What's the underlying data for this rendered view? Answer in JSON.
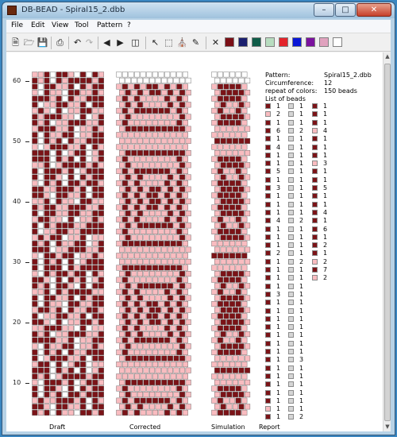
{
  "window": {
    "title": "DB-BEAD - Spiral15_2.dbb",
    "min": "–",
    "max": "□",
    "close": "✕"
  },
  "menu": [
    "File",
    "Edit",
    "View",
    "Tool",
    "Pattern",
    "?"
  ],
  "toolbar": {
    "icons": [
      "new-file-icon",
      "open-folder-icon",
      "save-icon",
      "print-icon",
      "undo-icon",
      "redo-icon",
      "arrow-left-icon",
      "arrow-right-icon",
      "preview-icon",
      "pointer-icon",
      "select-rect-icon",
      "fill-bucket-icon",
      "color-picker-icon",
      "clear-x-icon"
    ],
    "colors": [
      "#7b0f16",
      "#1b1f6e",
      "#0f5c48",
      "#b7dcbf",
      "#e3242b",
      "#0a16d6",
      "#7b129e",
      "#e0a2be",
      "#ffffff"
    ]
  },
  "ruler": {
    "labels": [
      "60",
      "50",
      "40",
      "30",
      "20",
      "10"
    ]
  },
  "colors": {
    "dark": "#7b1317",
    "pink": "#f9bcc0",
    "white": "#ffffff",
    "grey": "#d6d6d6"
  },
  "panels": {
    "draft": "Draft",
    "corrected": "Corrected",
    "simulation": "Simulation",
    "report": "Report"
  },
  "report": {
    "pattern_label": "Pattern:",
    "pattern_value": "Spiral15_2.dbb",
    "circ_label": "Circumference:",
    "circ_value": "12",
    "repeat_label": "repeat of colors:",
    "repeat_value": "150 beads",
    "list_label": "List of beads",
    "col1": [
      [
        "d",
        "1"
      ],
      [
        "p",
        "2"
      ],
      [
        "d",
        "1"
      ],
      [
        "d",
        "6"
      ],
      [
        "d",
        "1"
      ],
      [
        "d",
        "4"
      ],
      [
        "d",
        "1"
      ],
      [
        "d",
        "1"
      ],
      [
        "d",
        "5"
      ],
      [
        "d",
        "1"
      ],
      [
        "d",
        "3"
      ],
      [
        "d",
        "1"
      ],
      [
        "d",
        "1"
      ],
      [
        "d",
        "1"
      ],
      [
        "d",
        "4"
      ],
      [
        "d",
        "1"
      ],
      [
        "d",
        "1"
      ],
      [
        "d",
        "1"
      ],
      [
        "d",
        "2"
      ],
      [
        "d",
        "1"
      ],
      [
        "d",
        "1"
      ],
      [
        "d",
        "1"
      ],
      [
        "d",
        "1"
      ],
      [
        "d",
        "3"
      ],
      [
        "d",
        "1"
      ],
      [
        "d",
        "1"
      ],
      [
        "d",
        "1"
      ],
      [
        "d",
        "1"
      ],
      [
        "d",
        "1"
      ],
      [
        "d",
        "1"
      ],
      [
        "d",
        "1"
      ],
      [
        "d",
        "1"
      ],
      [
        "d",
        "1"
      ],
      [
        "d",
        "1"
      ],
      [
        "d",
        "1"
      ],
      [
        "d",
        "1"
      ],
      [
        "d",
        "1"
      ],
      [
        "p",
        "1"
      ],
      [
        "d",
        "1"
      ]
    ],
    "col2": [
      [
        "g",
        "1"
      ],
      [
        "g",
        "1"
      ],
      [
        "g",
        "1"
      ],
      [
        "g",
        "2"
      ],
      [
        "g",
        "1"
      ],
      [
        "g",
        "1"
      ],
      [
        "g",
        "1"
      ],
      [
        "g",
        "1"
      ],
      [
        "g",
        "1"
      ],
      [
        "g",
        "1"
      ],
      [
        "g",
        "1"
      ],
      [
        "g",
        "1"
      ],
      [
        "g",
        "1"
      ],
      [
        "g",
        "1"
      ],
      [
        "g",
        "2"
      ],
      [
        "g",
        "1"
      ],
      [
        "g",
        "1"
      ],
      [
        "g",
        "1"
      ],
      [
        "g",
        "1"
      ],
      [
        "g",
        "2"
      ],
      [
        "g",
        "1"
      ],
      [
        "g",
        "1"
      ],
      [
        "g",
        "1"
      ],
      [
        "g",
        "1"
      ],
      [
        "g",
        "1"
      ],
      [
        "g",
        "1"
      ],
      [
        "g",
        "1"
      ],
      [
        "g",
        "1"
      ],
      [
        "g",
        "1"
      ],
      [
        "g",
        "1"
      ],
      [
        "g",
        "1"
      ],
      [
        "g",
        "3"
      ],
      [
        "g",
        "1"
      ],
      [
        "g",
        "1"
      ],
      [
        "g",
        "1"
      ],
      [
        "g",
        "1"
      ],
      [
        "g",
        "1"
      ],
      [
        "g",
        "1"
      ],
      [
        "g",
        "2"
      ]
    ],
    "col3": [
      [
        "d",
        "1"
      ],
      [
        "d",
        "1"
      ],
      [
        "d",
        "1"
      ],
      [
        "p",
        "4"
      ],
      [
        "d",
        "1"
      ],
      [
        "d",
        "1"
      ],
      [
        "d",
        "1"
      ],
      [
        "p",
        "3"
      ],
      [
        "d",
        "1"
      ],
      [
        "d",
        "1"
      ],
      [
        "d",
        "5"
      ],
      [
        "d",
        "1"
      ],
      [
        "d",
        "1"
      ],
      [
        "d",
        "4"
      ],
      [
        "d",
        "1"
      ],
      [
        "d",
        "6"
      ],
      [
        "d",
        "1"
      ],
      [
        "d",
        "2"
      ],
      [
        "d",
        "1"
      ],
      [
        "p",
        "2"
      ],
      [
        "d",
        "7"
      ],
      [
        "p",
        "2"
      ]
    ]
  }
}
